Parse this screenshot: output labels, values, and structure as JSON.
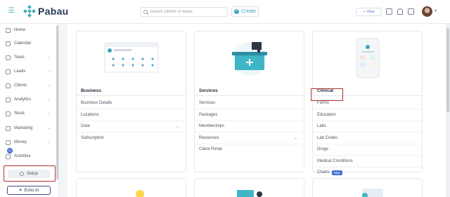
{
  "app": {
    "brand": "Pabau"
  },
  "topbar": {
    "search_placeholder": "Search clients or leads",
    "create_label": "Create",
    "view_label": "View"
  },
  "sidebar": {
    "items": [
      {
        "label": "Home",
        "icon": "home-icon",
        "has_chevron": false
      },
      {
        "label": "Calendar",
        "icon": "calendar-icon",
        "has_chevron": false
      },
      {
        "label": "Team",
        "icon": "team-icon",
        "has_chevron": true
      },
      {
        "label": "Leads",
        "icon": "leads-icon",
        "has_chevron": true
      },
      {
        "label": "Clients",
        "icon": "clients-icon",
        "has_chevron": true
      },
      {
        "label": "Analytics",
        "icon": "analytics-icon",
        "has_chevron": true
      },
      {
        "label": "Stock",
        "icon": "stock-icon",
        "has_chevron": true
      },
      {
        "label": "Marketing",
        "icon": "marketing-icon",
        "has_chevron": true
      },
      {
        "label": "Money",
        "icon": "money-icon",
        "has_chevron": true
      },
      {
        "label": "Activities",
        "icon": "activities-icon",
        "has_chevron": false,
        "badge": "12"
      }
    ],
    "setup_label": "Setup",
    "echo_label": "Echo AI"
  },
  "cards": {
    "business": {
      "title": "Business",
      "links": [
        {
          "label": "Business Details",
          "dropdown": false
        },
        {
          "label": "Locations",
          "dropdown": false
        },
        {
          "label": "Data",
          "dropdown": true
        },
        {
          "label": "Subscription",
          "dropdown": false
        }
      ]
    },
    "services": {
      "title": "Services",
      "links": [
        {
          "label": "Services",
          "dropdown": false
        },
        {
          "label": "Packages",
          "dropdown": false
        },
        {
          "label": "Memberships",
          "dropdown": false
        },
        {
          "label": "Resources",
          "dropdown": true
        },
        {
          "label": "Client Portal",
          "dropdown": false
        }
      ]
    },
    "clinical": {
      "title": "Clinical",
      "links": [
        {
          "label": "Forms",
          "dropdown": false
        },
        {
          "label": "Education",
          "dropdown": false
        },
        {
          "label": "Labs",
          "dropdown": false
        },
        {
          "label": "Lab Codes",
          "dropdown": false
        },
        {
          "label": "Drugs",
          "dropdown": false
        },
        {
          "label": "Medical Conditions",
          "dropdown": false
        },
        {
          "label": "Charts",
          "dropdown": false,
          "badge": "New"
        }
      ]
    }
  },
  "colors": {
    "brand": "#3aa7b6",
    "accent": "#4a6fd1",
    "highlight": "#b4312e"
  }
}
